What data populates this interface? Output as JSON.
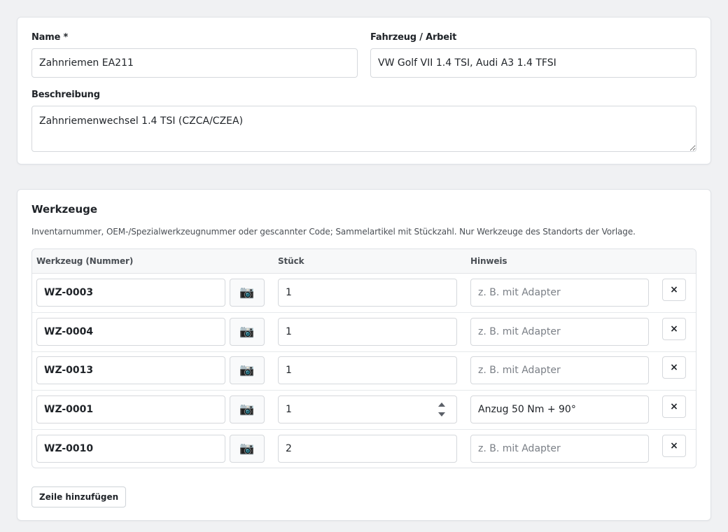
{
  "form": {
    "name_label": "Name *",
    "name_value": "Zahnriemen EA211",
    "vehicle_label": "Fahrzeug / Arbeit",
    "vehicle_value": "VW Golf VII 1.4 TSI, Audi A3 1.4 TFSI",
    "description_label": "Beschreibung",
    "description_value": "Zahnriemenwechsel 1.4 TSI (CZCA/CZEA)"
  },
  "tools": {
    "title": "Werkzeuge",
    "hint": "Inventarnummer, OEM-/Spezialwerkzeugnummer oder gescannter Code; Sammelartikel mit Stückzahl. Nur Werkzeuge des Standorts der Vorlage.",
    "columns": [
      "Werkzeug (Nummer)",
      "Stück",
      "Hinweis"
    ],
    "note_placeholder": "z. B. mit Adapter",
    "camera_icon": "📷",
    "delete_icon": "×",
    "rows": [
      {
        "tool": "WZ-0003",
        "qty": "1",
        "note": ""
      },
      {
        "tool": "WZ-0004",
        "qty": "1",
        "note": ""
      },
      {
        "tool": "WZ-0013",
        "qty": "1",
        "note": ""
      },
      {
        "tool": "WZ-0001",
        "qty": "1",
        "note": "Anzug 50 Nm + 90°"
      },
      {
        "tool": "WZ-0010",
        "qty": "2",
        "note": ""
      }
    ],
    "add_row_label": "Zeile hinzufügen"
  }
}
